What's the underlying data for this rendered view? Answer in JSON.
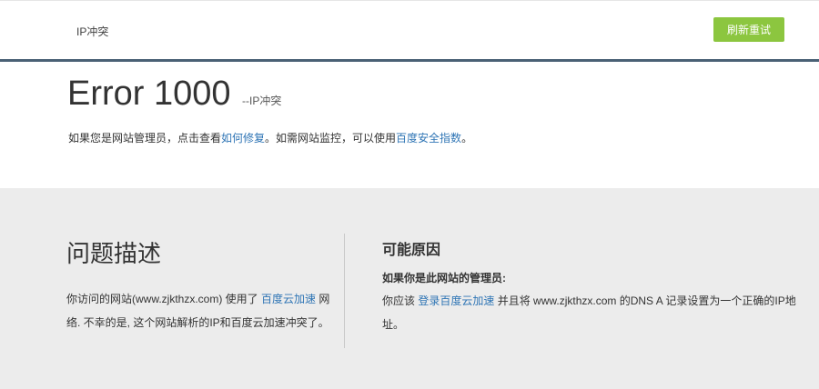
{
  "header": {
    "title": "IP冲突",
    "refresh_label": "刷新重试"
  },
  "error": {
    "title": "Error 1000",
    "subtitle": "--IP冲突",
    "note_pre": "如果您是网站管理员，点击查看",
    "note_link1": "如何修复",
    "note_mid": "。如需网站监控，可以使用",
    "note_link2": "百度安全指数",
    "note_post": "。"
  },
  "description": {
    "heading": "问题描述",
    "text_pre": "你访问的网站(www.zjkthzx.com) 使用了 ",
    "text_link": "百度云加速",
    "text_post": " 网络. 不幸的是, 这个网站解析的IP和百度云加速冲突了。"
  },
  "cause": {
    "heading": "可能原因",
    "admin_label": "如果你是此网站的管理员:",
    "text_pre": "你应该 ",
    "text_link": "登录百度云加速",
    "text_post": " 并且将 www.zjkthzx.com 的DNS A 记录设置为一个正确的IP地址。"
  },
  "colors": {
    "accent_green": "#8cc63f",
    "divider": "#4a6175",
    "link": "#2f75b5",
    "panel_gray": "#ececec"
  }
}
